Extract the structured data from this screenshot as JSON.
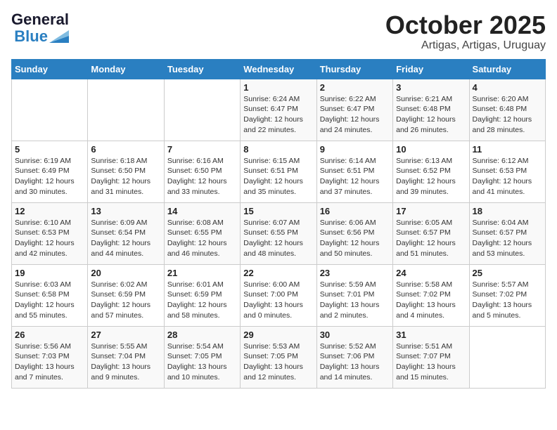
{
  "header": {
    "logo_text_general": "General",
    "logo_text_blue": "Blue",
    "title": "October 2025",
    "subtitle": "Artigas, Artigas, Uruguay"
  },
  "calendar": {
    "days_of_week": [
      "Sunday",
      "Monday",
      "Tuesday",
      "Wednesday",
      "Thursday",
      "Friday",
      "Saturday"
    ],
    "weeks": [
      [
        {
          "day": "",
          "info": ""
        },
        {
          "day": "",
          "info": ""
        },
        {
          "day": "",
          "info": ""
        },
        {
          "day": "1",
          "info": "Sunrise: 6:24 AM\nSunset: 6:47 PM\nDaylight: 12 hours\nand 22 minutes."
        },
        {
          "day": "2",
          "info": "Sunrise: 6:22 AM\nSunset: 6:47 PM\nDaylight: 12 hours\nand 24 minutes."
        },
        {
          "day": "3",
          "info": "Sunrise: 6:21 AM\nSunset: 6:48 PM\nDaylight: 12 hours\nand 26 minutes."
        },
        {
          "day": "4",
          "info": "Sunrise: 6:20 AM\nSunset: 6:48 PM\nDaylight: 12 hours\nand 28 minutes."
        }
      ],
      [
        {
          "day": "5",
          "info": "Sunrise: 6:19 AM\nSunset: 6:49 PM\nDaylight: 12 hours\nand 30 minutes."
        },
        {
          "day": "6",
          "info": "Sunrise: 6:18 AM\nSunset: 6:50 PM\nDaylight: 12 hours\nand 31 minutes."
        },
        {
          "day": "7",
          "info": "Sunrise: 6:16 AM\nSunset: 6:50 PM\nDaylight: 12 hours\nand 33 minutes."
        },
        {
          "day": "8",
          "info": "Sunrise: 6:15 AM\nSunset: 6:51 PM\nDaylight: 12 hours\nand 35 minutes."
        },
        {
          "day": "9",
          "info": "Sunrise: 6:14 AM\nSunset: 6:51 PM\nDaylight: 12 hours\nand 37 minutes."
        },
        {
          "day": "10",
          "info": "Sunrise: 6:13 AM\nSunset: 6:52 PM\nDaylight: 12 hours\nand 39 minutes."
        },
        {
          "day": "11",
          "info": "Sunrise: 6:12 AM\nSunset: 6:53 PM\nDaylight: 12 hours\nand 41 minutes."
        }
      ],
      [
        {
          "day": "12",
          "info": "Sunrise: 6:10 AM\nSunset: 6:53 PM\nDaylight: 12 hours\nand 42 minutes."
        },
        {
          "day": "13",
          "info": "Sunrise: 6:09 AM\nSunset: 6:54 PM\nDaylight: 12 hours\nand 44 minutes."
        },
        {
          "day": "14",
          "info": "Sunrise: 6:08 AM\nSunset: 6:55 PM\nDaylight: 12 hours\nand 46 minutes."
        },
        {
          "day": "15",
          "info": "Sunrise: 6:07 AM\nSunset: 6:55 PM\nDaylight: 12 hours\nand 48 minutes."
        },
        {
          "day": "16",
          "info": "Sunrise: 6:06 AM\nSunset: 6:56 PM\nDaylight: 12 hours\nand 50 minutes."
        },
        {
          "day": "17",
          "info": "Sunrise: 6:05 AM\nSunset: 6:57 PM\nDaylight: 12 hours\nand 51 minutes."
        },
        {
          "day": "18",
          "info": "Sunrise: 6:04 AM\nSunset: 6:57 PM\nDaylight: 12 hours\nand 53 minutes."
        }
      ],
      [
        {
          "day": "19",
          "info": "Sunrise: 6:03 AM\nSunset: 6:58 PM\nDaylight: 12 hours\nand 55 minutes."
        },
        {
          "day": "20",
          "info": "Sunrise: 6:02 AM\nSunset: 6:59 PM\nDaylight: 12 hours\nand 57 minutes."
        },
        {
          "day": "21",
          "info": "Sunrise: 6:01 AM\nSunset: 6:59 PM\nDaylight: 12 hours\nand 58 minutes."
        },
        {
          "day": "22",
          "info": "Sunrise: 6:00 AM\nSunset: 7:00 PM\nDaylight: 13 hours\nand 0 minutes."
        },
        {
          "day": "23",
          "info": "Sunrise: 5:59 AM\nSunset: 7:01 PM\nDaylight: 13 hours\nand 2 minutes."
        },
        {
          "day": "24",
          "info": "Sunrise: 5:58 AM\nSunset: 7:02 PM\nDaylight: 13 hours\nand 4 minutes."
        },
        {
          "day": "25",
          "info": "Sunrise: 5:57 AM\nSunset: 7:02 PM\nDaylight: 13 hours\nand 5 minutes."
        }
      ],
      [
        {
          "day": "26",
          "info": "Sunrise: 5:56 AM\nSunset: 7:03 PM\nDaylight: 13 hours\nand 7 minutes."
        },
        {
          "day": "27",
          "info": "Sunrise: 5:55 AM\nSunset: 7:04 PM\nDaylight: 13 hours\nand 9 minutes."
        },
        {
          "day": "28",
          "info": "Sunrise: 5:54 AM\nSunset: 7:05 PM\nDaylight: 13 hours\nand 10 minutes."
        },
        {
          "day": "29",
          "info": "Sunrise: 5:53 AM\nSunset: 7:05 PM\nDaylight: 13 hours\nand 12 minutes."
        },
        {
          "day": "30",
          "info": "Sunrise: 5:52 AM\nSunset: 7:06 PM\nDaylight: 13 hours\nand 14 minutes."
        },
        {
          "day": "31",
          "info": "Sunrise: 5:51 AM\nSunset: 7:07 PM\nDaylight: 13 hours\nand 15 minutes."
        },
        {
          "day": "",
          "info": ""
        }
      ]
    ]
  }
}
